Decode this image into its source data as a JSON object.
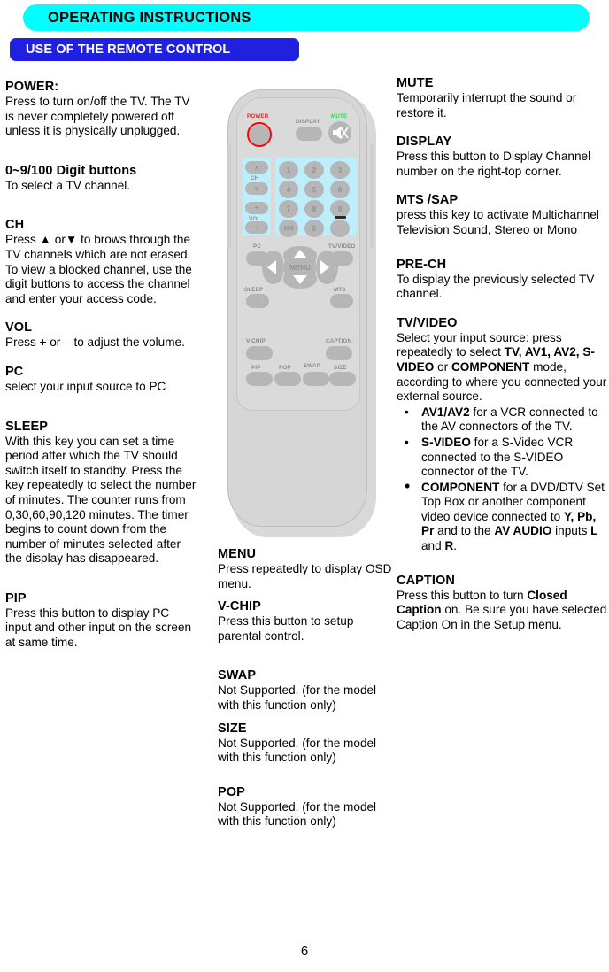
{
  "header": {
    "banner_title": "OPERATING INSTRUCTIONS",
    "section_title": "USE OF THE REMOTE CONTROL"
  },
  "page_number": "6",
  "left_column": [
    {
      "term": "POWER:",
      "body": "Press to turn on/off the TV. The TV is never completely powered off unless it is physically unplugged."
    },
    {
      "term": "0~9/100 Digit buttons",
      "body": "To select a TV channel."
    },
    {
      "term": "CH",
      "body": "Press ▲ or▼ to brows through the TV channels which are not erased. To view a blocked channel, use the digit buttons to access the channel and enter your access code."
    },
    {
      "term": "VOL",
      "body": "Press + or – to adjust the volume."
    },
    {
      "term": "PC",
      "body": "select your input source to PC"
    },
    {
      "term": "SLEEP",
      "body": "With this key you can set a time period after which the TV should switch itself to standby. Press the key repeatedly to select the number of minutes. The counter runs from 0,30,60,90,120 minutes. The timer begins to count down from the number of minutes selected after the display has disappeared."
    },
    {
      "term": "PIP",
      "body": "Press this button to display PC input and other input on the screen at same time."
    }
  ],
  "middle_column": [
    {
      "term": "MENU",
      "body": "Press repeatedly to display OSD menu."
    },
    {
      "term": "V-CHIP",
      "body": "Press this button to setup parental control."
    },
    {
      "term": "SWAP",
      "body": "Not Supported. (for the model with this function only)"
    },
    {
      "term": "SIZE",
      "body": "Not Supported. (for the model with this function only)"
    },
    {
      "term": "POP",
      "body": "Not Supported. (for the model with this function only)"
    }
  ],
  "right_column": {
    "mute": {
      "term": "MUTE",
      "body": "Temporarily interrupt the sound or restore it."
    },
    "display": {
      "term": "DISPLAY",
      "body": "Press this button to Display Channel number on the right-top corner."
    },
    "mts_sap": {
      "term": "MTS /SAP",
      "body": "press this key to activate Multichannel Television Sound, Stereo or Mono"
    },
    "pre_ch": {
      "term": "PRE-CH",
      "body": "To display the previously selected TV channel."
    },
    "tv_video": {
      "term": "TV/VIDEO",
      "intro_line1": "Select your input source:",
      "intro_line2": "press repeatedly to select",
      "modes_bold_1": "TV, AV1, AV2, S-VIDEO",
      "modes_or": " or ",
      "modes_bold_2": "COMPONENT",
      "modes_tail": " mode,",
      "intro_line3": "according to where you connected your external source.",
      "bullets": [
        {
          "bold": "AV1/AV2",
          "text": " for a VCR connected to the AV connectors of the TV."
        },
        {
          "bold": "S-VIDEO",
          "text": " for a S-Video VCR connected to the S-VIDEO connector of the TV."
        },
        {
          "bold": "COMPONENT",
          "text_1": " for a DVD/DTV Set Top Box or another component video device connected to ",
          "bold_2": "Y, Pb, Pr",
          "text_2": " and to the ",
          "bold_3": "AV AUDIO",
          "text_3": " inputs ",
          "bold_4": "L",
          "text_4": " and ",
          "bold_5": "R",
          "text_5": "."
        }
      ]
    },
    "caption": {
      "term": "CAPTION",
      "line1_a": "Press this button to turn ",
      "line1_bold": "Closed Caption",
      "line1_b": " on.",
      "line2": "Be sure you have selected Caption On in the Setup menu."
    }
  },
  "remote": {
    "labels": {
      "power": "POWER",
      "mute": "MUTE",
      "display": "DISPLAY",
      "ch": "CH",
      "vol": "VOL",
      "pc": "PC",
      "tv_video": "TV/VIDEO",
      "sleep": "SLEEP",
      "mts": "MTS",
      "v_chip": "V-CHIP",
      "caption": "CAPTION",
      "pip": "PIP",
      "pop": "POP",
      "swap": "SWAP",
      "size": "SIZE",
      "menu": "MENU"
    },
    "ch_up": "∧",
    "ch_down": "∨",
    "vol_up": "+",
    "vol_down": "–",
    "keys": [
      "1",
      "2",
      "3",
      "4",
      "5",
      "6",
      "7",
      "8",
      "9",
      "100",
      "0"
    ],
    "colors": {
      "body": "#d6d6d6",
      "button": "#b6b6b6",
      "keypad_highlight": "#bdeefb",
      "power_ring": "#ff0000",
      "power_label": "#ff1a1a",
      "mute_label": "#22dd55"
    }
  }
}
